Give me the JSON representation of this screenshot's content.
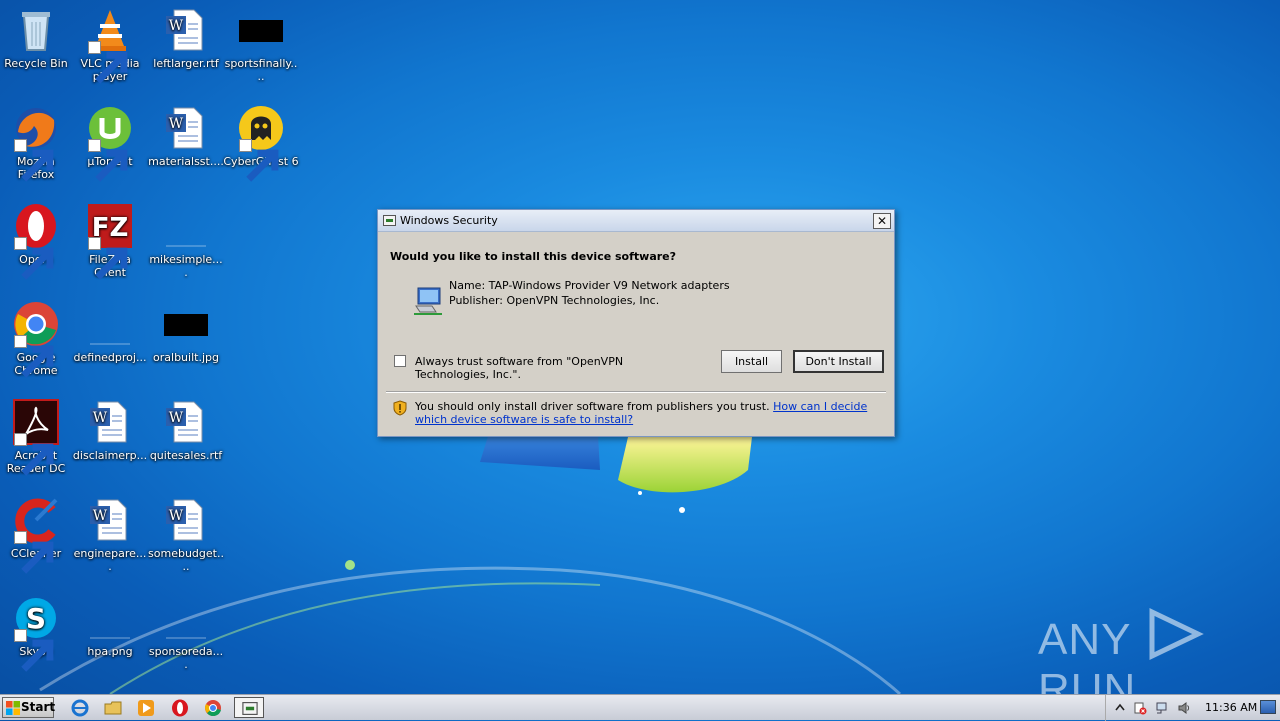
{
  "desktop": {
    "icons": [
      {
        "label": "Recycle Bin",
        "icon": "recycle-bin-icon"
      },
      {
        "label": "VLC media player",
        "icon": "vlc-icon"
      },
      {
        "label": "leftlarger.rtf",
        "icon": "word-doc-icon"
      },
      {
        "label": "sportsfinally....",
        "icon": "image-thumbnail-icon"
      },
      {
        "label": "Mozilla Firefox",
        "icon": "firefox-icon"
      },
      {
        "label": "µTorrent",
        "icon": "utorrent-icon"
      },
      {
        "label": "materialsst....",
        "icon": "word-doc-icon"
      },
      {
        "label": "CyberGhost 6",
        "icon": "cyberghost-icon"
      },
      {
        "label": "Opera",
        "icon": "opera-icon"
      },
      {
        "label": "FileZilla Client",
        "icon": "filezilla-icon"
      },
      {
        "label": "mikesimple....",
        "icon": "blank-file-icon"
      },
      {
        "label": "Google Chrome",
        "icon": "chrome-icon"
      },
      {
        "label": "definedproj...",
        "icon": "blank-file-icon"
      },
      {
        "label": "oralbuilt.jpg",
        "icon": "image-thumbnail-icon"
      },
      {
        "label": "Acrobat Reader DC",
        "icon": "acrobat-icon"
      },
      {
        "label": "disclaimerp...",
        "icon": "word-doc-icon"
      },
      {
        "label": "quitesales.rtf",
        "icon": "word-doc-icon"
      },
      {
        "label": "CCleaner",
        "icon": "ccleaner-icon"
      },
      {
        "label": "enginepare....",
        "icon": "word-doc-icon"
      },
      {
        "label": "somebudget....",
        "icon": "word-doc-icon"
      },
      {
        "label": "Skype",
        "icon": "skype-icon"
      },
      {
        "label": "hpa.png",
        "icon": "blank-file-icon"
      },
      {
        "label": "sponsoreda....",
        "icon": "blank-file-icon"
      }
    ]
  },
  "dialog": {
    "title": "Windows Security",
    "close_label": "✕",
    "question": "Would you like to install this device software?",
    "name_line": "Name: TAP-Windows Provider V9 Network adapters",
    "publisher_line": "Publisher: OpenVPN Technologies, Inc.",
    "trust_label": "Always trust software from \"OpenVPN Technologies, Inc.\".",
    "trust_checked": false,
    "install_label": "Install",
    "dont_install_label": "Don't Install",
    "warning_text": "You should only install driver software from publishers you trust.",
    "help_link": "How can I decide which device software is safe to install?"
  },
  "taskbar": {
    "start_label": "Start",
    "pinned": [
      "internet-explorer-icon",
      "folder-icon",
      "media-player-icon",
      "opera-icon",
      "chrome-icon",
      "security-dialog-icon"
    ],
    "clock": "11:36 AM"
  },
  "watermark": {
    "left": "ANY",
    "right": "RUN"
  },
  "colors": {
    "dialog_bg": "#d4d0c8",
    "link": "#0033cc",
    "desktop_blue": "#1176cf"
  }
}
